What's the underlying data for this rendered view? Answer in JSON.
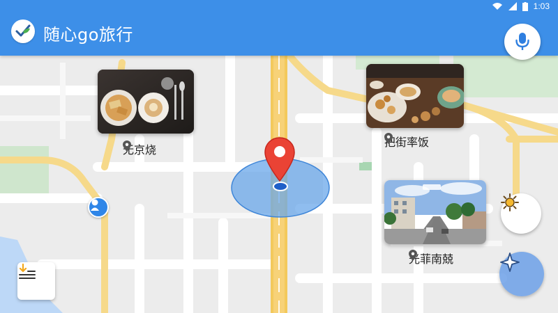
{
  "status_bar": {
    "time": "1:03",
    "wifi_icon": "wifi-icon",
    "signal_icon": "signal-icon",
    "battery_icon": "battery-icon"
  },
  "app_bar": {
    "title": "随心go旅行",
    "logo_icon": "check-leaf-logo-icon",
    "mic_icon": "microphone-icon",
    "color": "#3d8fe8"
  },
  "map": {
    "current_location_icon": "map-pin-icon",
    "accuracy_color": "#6aa7ea",
    "places": [
      {
        "label": "无京烧",
        "image": "food-plate-photo",
        "pin_icon": "location-pin-icon"
      },
      {
        "label": "把街率饭",
        "image": "breakfast-table-photo",
        "pin_icon": "location-pin-icon"
      },
      {
        "label": "光菲南兢",
        "image": "street-view-photo",
        "pin_icon": "location-pin-icon"
      }
    ]
  },
  "controls": {
    "brightness_icon": "sun-icon",
    "navigate_icon": "compass-star-icon",
    "route_icon": "route-download-icon",
    "user_marker_icon": "person-marker-icon"
  }
}
